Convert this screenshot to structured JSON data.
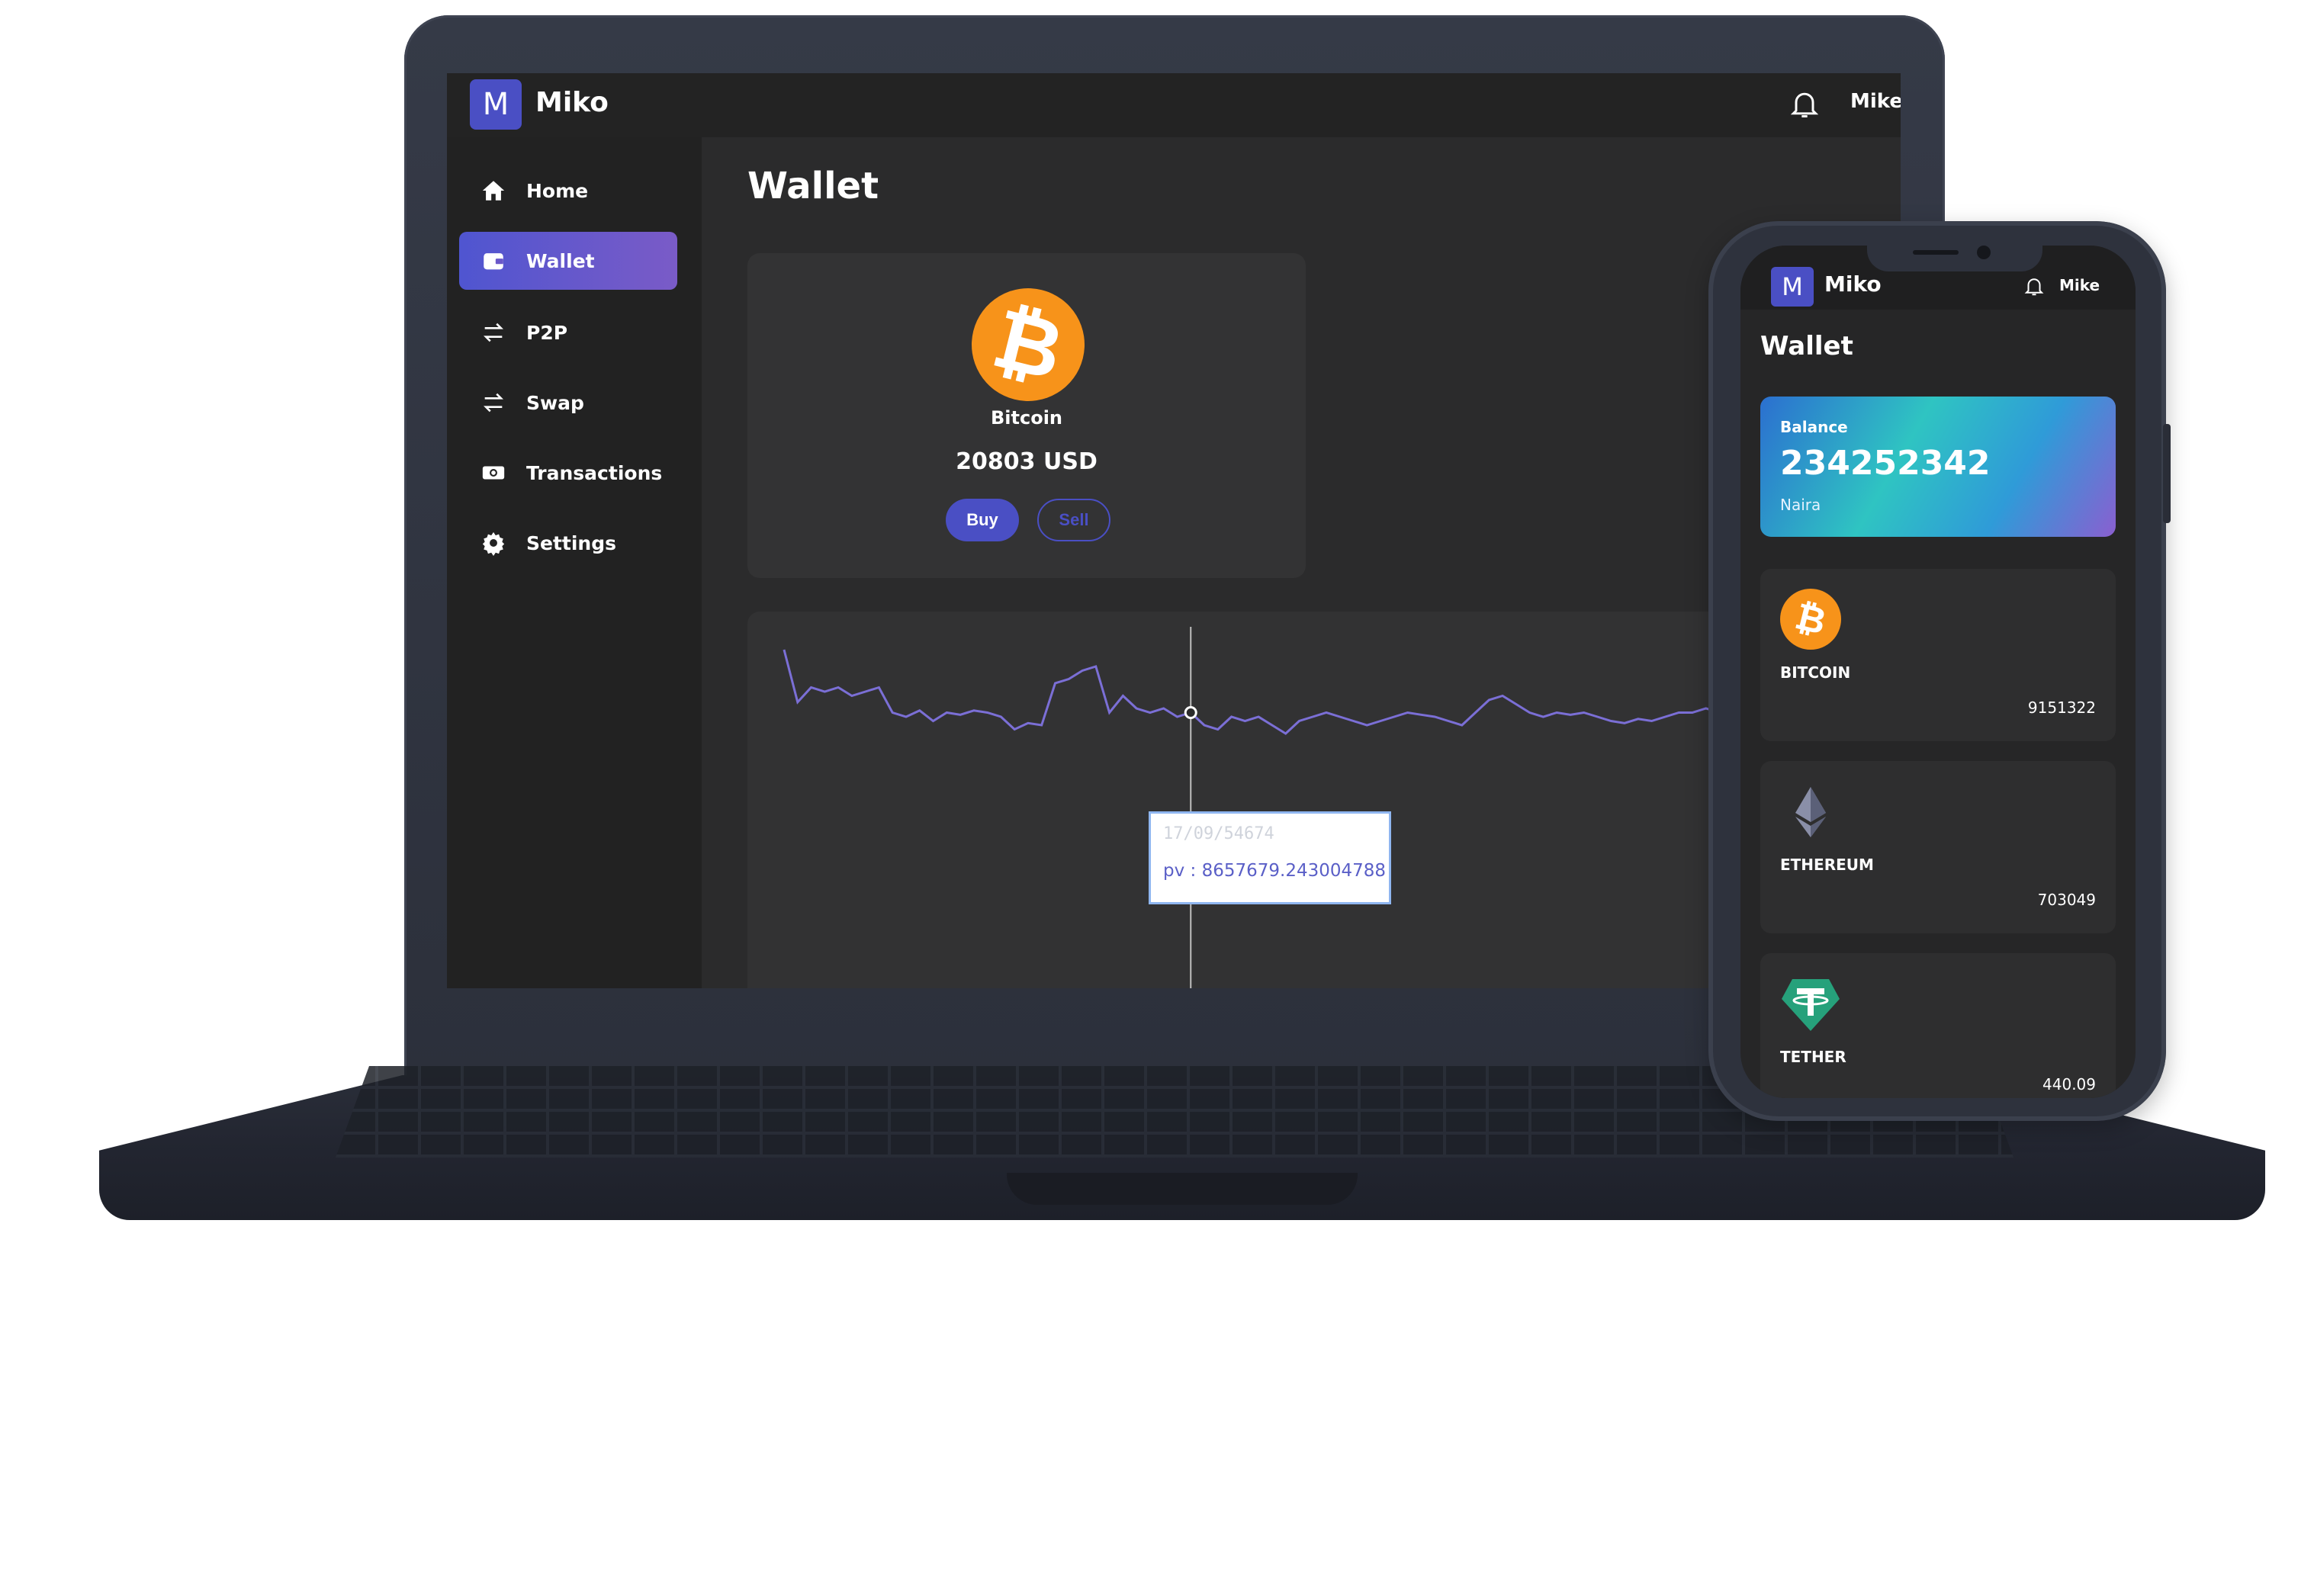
{
  "desktop": {
    "app_name": "Miko",
    "logo_letter": "M",
    "user": "Mike",
    "nav": [
      {
        "label": "Home",
        "icon": "home-icon",
        "active": false
      },
      {
        "label": "Wallet",
        "icon": "wallet-icon",
        "active": true
      },
      {
        "label": "P2P",
        "icon": "swap-arrows-icon",
        "active": false
      },
      {
        "label": "Swap",
        "icon": "swap-arrows-icon",
        "active": false
      },
      {
        "label": "Transactions",
        "icon": "money-icon",
        "active": false
      },
      {
        "label": "Settings",
        "icon": "gear-icon",
        "active": false
      }
    ],
    "page_title": "Wallet",
    "coin": {
      "name": "Bitcoin",
      "symbol_glyph": "₿",
      "price": "20803 USD",
      "buy_label": "Buy",
      "sell_label": "Sell"
    },
    "tooltip": {
      "date": "17/09/54674",
      "value": "pv : 8657679.243004788"
    }
  },
  "chart_data": {
    "type": "line",
    "series": [
      {
        "values": [
          60,
          35,
          42,
          40,
          42,
          38,
          40,
          42,
          30,
          28,
          31,
          26,
          30,
          29,
          31,
          30,
          28,
          22,
          25,
          24,
          44,
          46,
          50,
          52,
          30,
          38,
          32,
          30,
          32,
          28,
          30,
          24,
          22,
          28,
          26,
          28,
          24,
          20,
          26,
          28,
          30,
          28,
          26,
          24,
          26,
          28,
          30,
          29,
          28,
          26,
          24,
          30,
          36,
          38,
          34,
          30,
          28,
          30,
          29,
          30,
          28,
          26,
          25,
          27,
          26,
          28,
          30,
          30,
          32,
          30,
          28,
          29,
          30,
          30,
          32,
          34,
          38,
          42,
          40,
          44,
          42
        ]
      }
    ],
    "highlight_index": 30,
    "line_color": "#7b6fd6",
    "grid": false,
    "legend": "none"
  },
  "mobile": {
    "logo_letter": "M",
    "app_name": "Miko",
    "user": "Mike",
    "page_title": "Wallet",
    "balance": {
      "label": "Balance",
      "amount": "234252342",
      "currency": "Naira"
    },
    "coins": [
      {
        "name": "BITCOIN",
        "value": "9151322",
        "icon": "bitcoin-icon"
      },
      {
        "name": "ETHEREUM",
        "value": "703049",
        "icon": "ethereum-icon"
      },
      {
        "name": "TETHER",
        "value": "440.09",
        "icon": "tether-icon"
      }
    ]
  },
  "colors": {
    "accent": "#4a4fc4",
    "bitcoin": "#f7931a",
    "tether": "#26a17b",
    "background": "#2b2b2c"
  }
}
